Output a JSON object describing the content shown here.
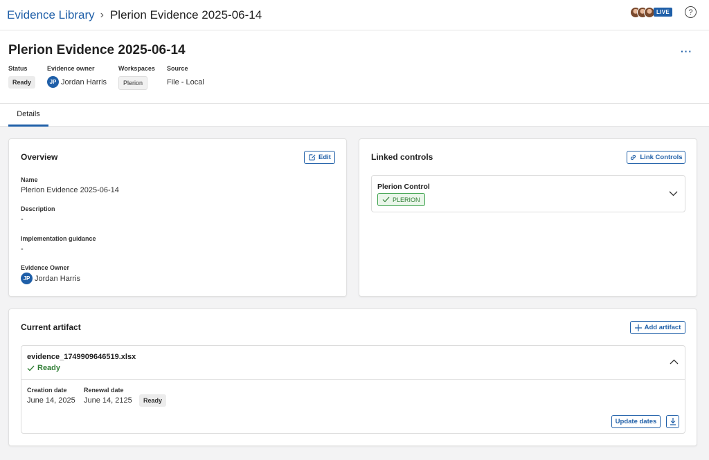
{
  "breadcrumb": {
    "parent": "Evidence Library",
    "separator": "›",
    "current": "Plerion Evidence 2025-06-14"
  },
  "topbar": {
    "live_label": "LIVE",
    "help_glyph": "?"
  },
  "header": {
    "title": "Plerion Evidence 2025-06-14",
    "more_glyph": "···",
    "status_label": "Status",
    "status_value": "Ready",
    "owner_label": "Evidence owner",
    "owner_initials": "JP",
    "owner_name": "Jordan Harris",
    "workspaces_label": "Workspaces",
    "workspace_value": "Plerion",
    "source_label": "Source",
    "source_value": "File - Local"
  },
  "tabs": [
    {
      "label": "Details",
      "active": true
    }
  ],
  "overview": {
    "title": "Overview",
    "edit_label": "Edit",
    "name_label": "Name",
    "name_value": "Plerion Evidence 2025-06-14",
    "description_label": "Description",
    "description_value": "-",
    "guidance_label": "Implementation guidance",
    "guidance_value": "-",
    "owner_label": "Evidence Owner",
    "owner_initials": "JP",
    "owner_name": "Jordan Harris"
  },
  "linked_controls": {
    "title": "Linked controls",
    "link_button_label": "Link Controls",
    "controls": [
      {
        "name": "Plerion Control",
        "workspace_tag": "PLERION"
      }
    ]
  },
  "current_artifact": {
    "title": "Current artifact",
    "add_button_label": "Add artifact",
    "file_name": "evidence_1749909646519.xlsx",
    "status": "Ready",
    "creation_label": "Creation date",
    "creation_value": "June 14, 2025",
    "renewal_label": "Renewal date",
    "renewal_value": "June 14, 2125",
    "renewal_status": "Ready",
    "update_dates_label": "Update dates"
  },
  "colors": {
    "accent": "#1f5fa8",
    "success": "#2f7d34",
    "background": "#f3f3f4"
  }
}
